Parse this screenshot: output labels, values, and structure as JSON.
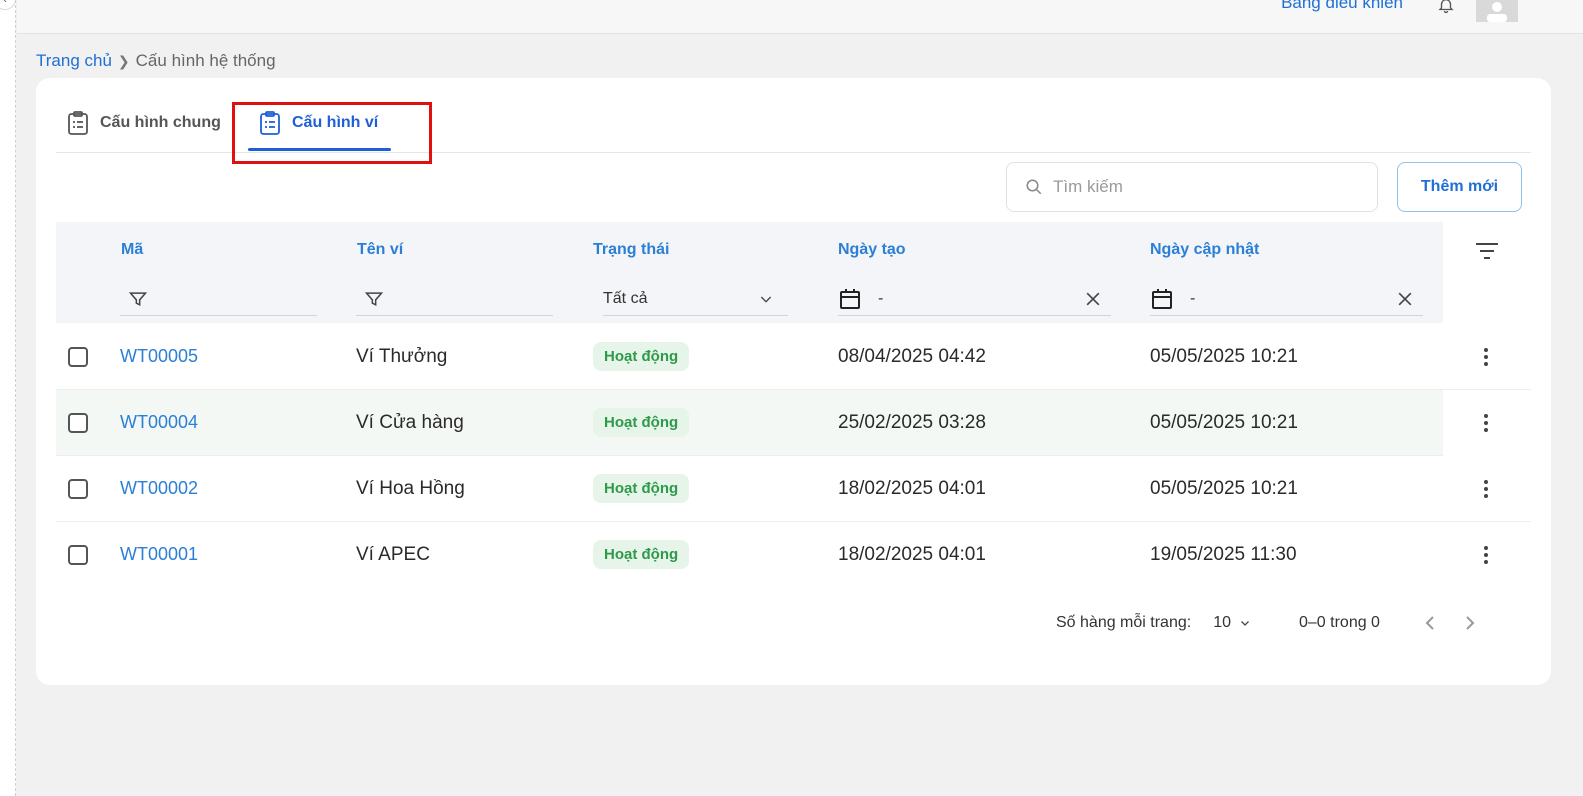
{
  "topbar": {
    "dashboard_link": "Bảng điều khiển",
    "bell_icon": "bell-icon",
    "avatar_icon": "user-avatar-icon"
  },
  "breadcrumb": {
    "home": "Trang chủ",
    "current": "Cấu hình hệ thống"
  },
  "tabs": [
    {
      "label": "Cấu hình chung",
      "icon": "clipboard-list-icon",
      "active": false
    },
    {
      "label": "Cấu hình ví",
      "icon": "clipboard-list-icon",
      "active": true
    }
  ],
  "toolbar": {
    "search_placeholder": "Tìm kiếm",
    "add_label": "Thêm mới"
  },
  "table": {
    "columns": {
      "code": "Mã",
      "name": "Tên ví",
      "status": "Trạng thái",
      "created": "Ngày tạo",
      "updated": "Ngày cập nhật"
    },
    "filters": {
      "status_value": "Tất cả",
      "created_value": "-",
      "updated_value": "-"
    },
    "rows": [
      {
        "code": "WT00005",
        "name": "Ví Thưởng",
        "status": "Hoạt động",
        "created": "08/04/2025 04:42",
        "updated": "05/05/2025 10:21"
      },
      {
        "code": "WT00004",
        "name": "Ví Cửa hàng",
        "status": "Hoạt động",
        "created": "25/02/2025 03:28",
        "updated": "05/05/2025 10:21"
      },
      {
        "code": "WT00002",
        "name": "Ví Hoa Hồng",
        "status": "Hoạt động",
        "created": "18/02/2025 04:01",
        "updated": "05/05/2025 10:21"
      },
      {
        "code": "WT00001",
        "name": "Ví APEC",
        "status": "Hoạt động",
        "created": "18/02/2025 04:01",
        "updated": "19/05/2025 11:30"
      }
    ]
  },
  "pagination": {
    "rows_per_page_label": "Số hàng mỗi trang:",
    "rows_per_page_value": "10",
    "range": "0–0 trong 0"
  },
  "colors": {
    "accent": "#1f5fd6",
    "link": "#2b7fd6",
    "status_bg": "#e6f4ea",
    "status_text": "#2e9a4a",
    "highlight_border": "#e01010"
  }
}
